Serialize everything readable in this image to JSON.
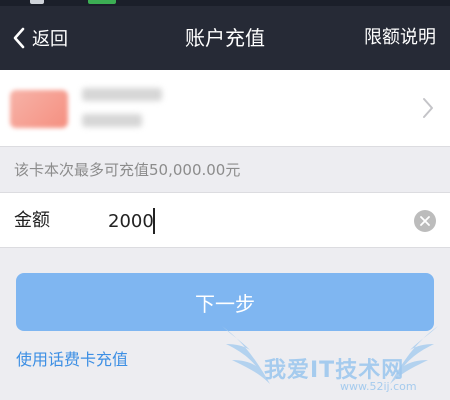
{
  "nav": {
    "back_label": "返回",
    "title": "账户充值",
    "right_action": "限额说明"
  },
  "card": {
    "logo_color": "#f59b8e"
  },
  "limit_notice": "该卡本次最多可充值50,000.00元",
  "amount": {
    "label": "金额",
    "value": "2000"
  },
  "primary_button": "下一步",
  "alt_link": "使用话费卡充值",
  "watermark": {
    "text": "我爱IT技术网",
    "url": "www.52ij.com"
  },
  "colors": {
    "navbar": "#262a36",
    "primary": "#7fb6f1",
    "link": "#3d8fe4",
    "background": "#ededf1"
  }
}
